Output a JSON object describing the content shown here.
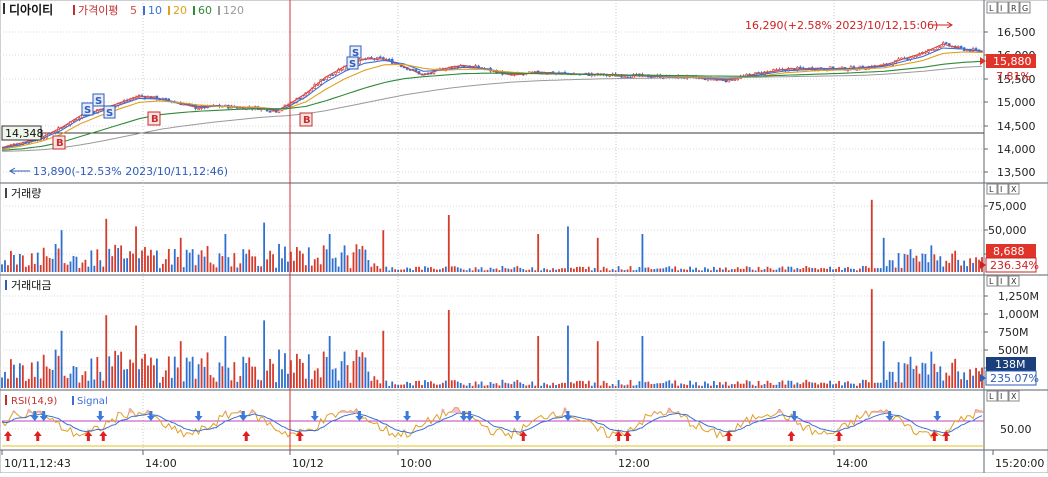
{
  "app": {
    "stock_name": "디아이티",
    "price_indicator": "가격이평",
    "ma_labels": [
      {
        "text": "5",
        "color": "#d24a4a"
      },
      {
        "text": "10",
        "color": "#3a6fd8"
      },
      {
        "text": "20",
        "color": "#e0a020"
      },
      {
        "text": "60",
        "color": "#2f8a3b"
      },
      {
        "text": "120",
        "color": "#9a9a9a"
      }
    ],
    "toolbar_buttons": [
      "L",
      "I",
      "R",
      "G"
    ],
    "panel_buttons": [
      "L",
      "I",
      "X"
    ]
  },
  "colors": {
    "up": "#d63a2b",
    "down": "#2f6fd0",
    "rsi": "#e0a020",
    "signal": "#3a6fd8",
    "badge_red": "#e0332a",
    "badge_green": "#2e8a3b",
    "badge_navy": "#1b3f7a",
    "vline": "#d03030"
  },
  "price_panel": {
    "high_note": "16,290(+2.58% 2023/10/12,15:06)",
    "low_note": "13,890(-12.53% 2023/10/11,12:46)",
    "ref_price_label": "14,348",
    "current_price": "15,880",
    "change_pct": "7.81%",
    "y_ticks": [
      "16,500",
      "16,000",
      "15,500",
      "15,000",
      "14,500",
      "14,000",
      "13,500"
    ]
  },
  "volume_panel": {
    "title": "거래량",
    "y_ticks": [
      "75,000",
      "50,000",
      "25,000"
    ],
    "current_value": "8,688",
    "pct": "236.34%"
  },
  "amount_panel": {
    "title": "거래대금",
    "y_ticks": [
      "1,250M",
      "1,000M",
      "750M",
      "500M",
      "250M"
    ],
    "current_value": "138M",
    "pct": "235.07%"
  },
  "rsi_panel": {
    "title": "RSI(14,9)",
    "signal_label": "Signal",
    "y_tick": "50.00"
  },
  "x_axis": {
    "labels": [
      "10/11,12:43",
      "14:00",
      "10/12",
      "10:00",
      "12:00",
      "14:00",
      "15:20:00"
    ]
  },
  "chart_data": {
    "type": "line",
    "title": "디아이티",
    "x_range": [
      "2023/10/11 12:43",
      "2023/10/12 15:20"
    ],
    "price": {
      "ylim": [
        13300,
        16800
      ],
      "x": [
        0,
        0.02,
        0.04,
        0.06,
        0.08,
        0.1,
        0.12,
        0.14,
        0.16,
        0.18,
        0.2,
        0.22,
        0.24,
        0.26,
        0.28,
        0.29,
        0.31,
        0.33,
        0.35,
        0.37,
        0.39,
        0.41,
        0.43,
        0.45,
        0.47,
        0.49,
        0.52,
        0.55,
        0.58,
        0.62,
        0.66,
        0.7,
        0.74,
        0.77,
        0.8,
        0.83,
        0.86,
        0.88,
        0.9,
        0.92,
        0.94,
        0.96,
        0.98,
        1.0
      ],
      "series": [
        {
          "name": "5",
          "values": [
            13960,
            14050,
            14160,
            14350,
            14600,
            14720,
            14860,
            15000,
            14950,
            14860,
            14760,
            14800,
            14770,
            14760,
            14700,
            14800,
            15050,
            15380,
            15600,
            15750,
            15750,
            15600,
            15420,
            15550,
            15620,
            15560,
            15420,
            15480,
            15450,
            15420,
            15400,
            15380,
            15320,
            15450,
            15540,
            15560,
            15550,
            15580,
            15620,
            15750,
            15870,
            16050,
            15950,
            15900
          ]
        },
        {
          "name": "10",
          "values": [
            13940,
            14020,
            14130,
            14300,
            14540,
            14680,
            14820,
            14950,
            14940,
            14870,
            14790,
            14790,
            14780,
            14770,
            14720,
            14760,
            14980,
            15280,
            15500,
            15660,
            15720,
            15650,
            15500,
            15520,
            15580,
            15560,
            15460,
            15460,
            15450,
            15430,
            15410,
            15380,
            15340,
            15420,
            15510,
            15540,
            15550,
            15570,
            15600,
            15700,
            15800,
            15970,
            15950,
            15910
          ]
        },
        {
          "name": "20",
          "values": [
            13920,
            13990,
            14080,
            14220,
            14440,
            14600,
            14740,
            14870,
            14900,
            14870,
            14820,
            14790,
            14780,
            14770,
            14740,
            14740,
            14880,
            15130,
            15350,
            15520,
            15630,
            15640,
            15560,
            15520,
            15540,
            15540,
            15480,
            15450,
            15440,
            15430,
            15420,
            15390,
            15360,
            15390,
            15470,
            15510,
            15530,
            15550,
            15570,
            15640,
            15720,
            15860,
            15890,
            15880
          ]
        },
        {
          "name": "60",
          "values": [
            13900,
            13930,
            13980,
            14060,
            14180,
            14300,
            14420,
            14540,
            14620,
            14660,
            14690,
            14710,
            14730,
            14740,
            14740,
            14740,
            14790,
            14900,
            15030,
            15160,
            15270,
            15350,
            15390,
            15420,
            15450,
            15460,
            15460,
            15450,
            15440,
            15430,
            15420,
            15410,
            15400,
            15400,
            15420,
            15440,
            15460,
            15480,
            15500,
            15540,
            15580,
            15640,
            15680,
            15700
          ]
        },
        {
          "name": "120",
          "values": [
            13880,
            13890,
            13910,
            13950,
            14010,
            14080,
            14160,
            14240,
            14320,
            14380,
            14430,
            14480,
            14520,
            14560,
            14590,
            14600,
            14640,
            14700,
            14780,
            14860,
            14940,
            15020,
            15080,
            15140,
            15190,
            15230,
            15280,
            15310,
            15330,
            15350,
            15360,
            15370,
            15370,
            15380,
            15390,
            15400,
            15410,
            15420,
            15440,
            15470,
            15500,
            15540,
            15580,
            15600
          ]
        }
      ]
    },
    "volume": {
      "ylim": [
        0,
        90000
      ]
    },
    "amount": {
      "ylim": [
        0,
        1500
      ]
    },
    "rsi": {
      "ylim": [
        0,
        100
      ]
    }
  }
}
